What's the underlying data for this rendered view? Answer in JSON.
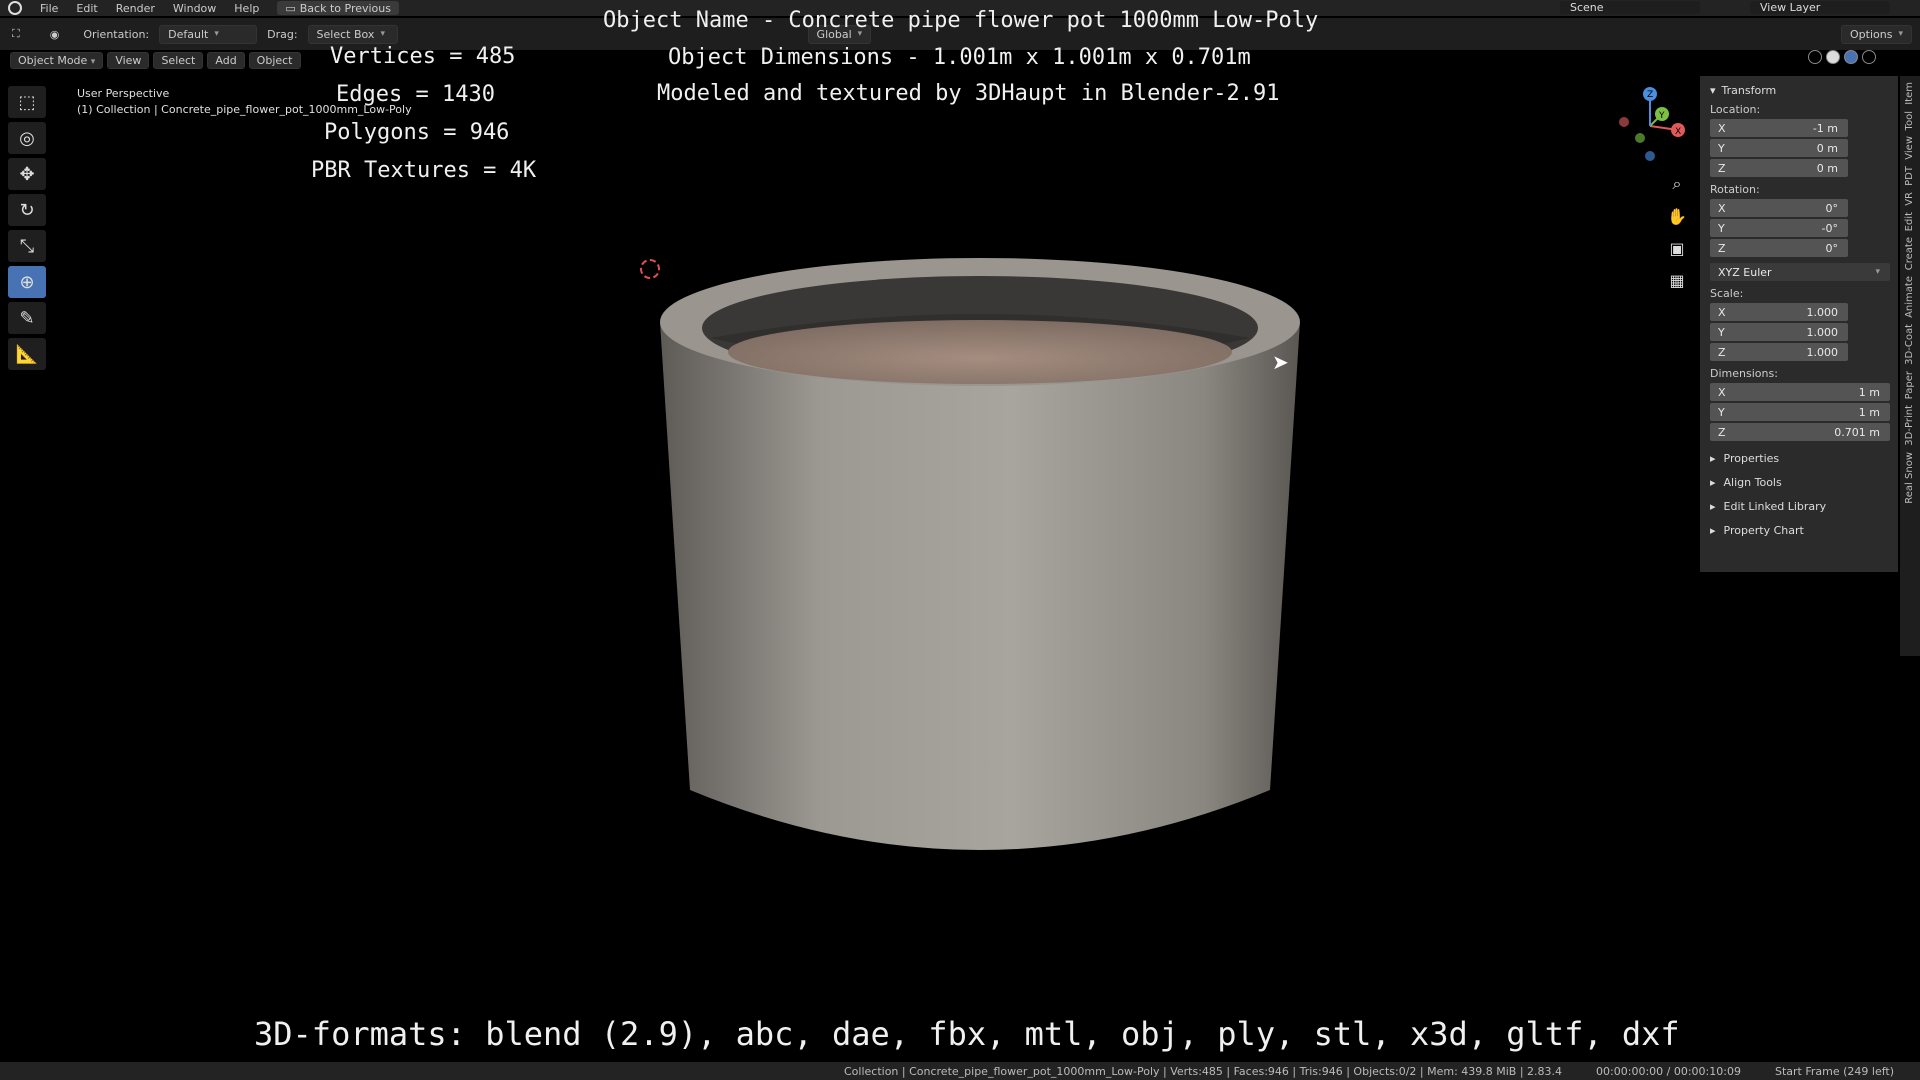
{
  "menu": [
    "File",
    "Edit",
    "Render",
    "Window",
    "Help"
  ],
  "back_button": "Back to Previous",
  "scene": "Scene",
  "view_layer": "View Layer",
  "header": {
    "orientation_label": "Orientation:",
    "orientation_value": "Default",
    "drag_label": "Drag:",
    "drag_value": "Select Box",
    "transform_orientation": "Global",
    "options": "Options"
  },
  "mode_bar": {
    "mode": "Object Mode",
    "view": "View",
    "select": "Select",
    "add": "Add",
    "object": "Object"
  },
  "viewport": {
    "perspective": "User Perspective",
    "collection": "(1) Collection | Concrete_pipe_flower_pot_1000mm_Low-Poly"
  },
  "overlay": {
    "title": "Object Name - Concrete pipe flower pot 1000mm Low-Poly",
    "dimensions": "Object Dimensions -  1.001m x 1.001m x 0.701m",
    "credit": "Modeled and textured by 3DHaupt in Blender-2.91",
    "vertices": "Vertices = 485",
    "edges": "Edges = 1430",
    "polygons": "Polygons = 946",
    "pbr": "PBR Textures = 4K",
    "formats": "3D-formats: blend (2.9), abc, dae, fbx, mtl, obj, ply, stl, x3d, gltf, dxf"
  },
  "npanel": {
    "transform": "Transform",
    "location_label": "Location:",
    "location": [
      {
        "axis": "X",
        "value": "-1 m"
      },
      {
        "axis": "Y",
        "value": "0 m"
      },
      {
        "axis": "Z",
        "value": "0 m"
      }
    ],
    "rotation_label": "Rotation:",
    "rotation": [
      {
        "axis": "X",
        "value": "0°"
      },
      {
        "axis": "Y",
        "value": "-0°"
      },
      {
        "axis": "Z",
        "value": "0°"
      }
    ],
    "rotation_mode": "XYZ Euler",
    "scale_label": "Scale:",
    "scale": [
      {
        "axis": "X",
        "value": "1.000"
      },
      {
        "axis": "Y",
        "value": "1.000"
      },
      {
        "axis": "Z",
        "value": "1.000"
      }
    ],
    "dimensions_label": "Dimensions:",
    "dimensions": [
      {
        "axis": "X",
        "value": "1 m"
      },
      {
        "axis": "Y",
        "value": "1 m"
      },
      {
        "axis": "Z",
        "value": "0.701 m"
      }
    ],
    "panels": [
      "Properties",
      "Align Tools",
      "Edit Linked Library",
      "Property Chart"
    ]
  },
  "side_tabs": [
    "Item",
    "Tool",
    "View",
    "PDT",
    "VR",
    "Edit",
    "Create",
    "Animate",
    "3D-Coat",
    "Paper",
    "3D-Print",
    "Real Snow"
  ],
  "status": {
    "stats": "Collection | Concrete_pipe_flower_pot_1000mm_Low-Poly | Verts:485 | Faces:946 | Tris:946 | Objects:0/2 | Mem: 439.8 MiB | 2.83.4",
    "time": "00:00:00:00 / 00:00:10:09",
    "frame": "Start Frame (249 left)"
  },
  "gizmo_axes": [
    "X",
    "Y",
    "Z"
  ]
}
